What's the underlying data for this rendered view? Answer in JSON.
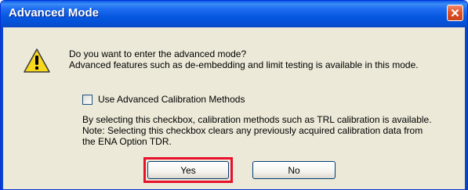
{
  "window": {
    "title": "Advanced Mode",
    "close_icon": "close-icon"
  },
  "dialog": {
    "icon": "warning-icon",
    "question": "Do you want to enter the advanced mode?",
    "description": "Advanced features such as de-embedding and limit testing is available in this mode.",
    "checkbox_label": "Use Advanced Calibration Methods",
    "checkbox_checked": false,
    "note_line1": "By selecting this checkbox, calibration methods such as TRL calibration is available.",
    "note_line2": "Note: Selecting this checkbox clears any previously acquired calibration data from",
    "note_line3": "the ENA Option TDR."
  },
  "buttons": {
    "yes_label": "Yes",
    "no_label": "No"
  },
  "colors": {
    "titlebar": "#0657e0",
    "dialog_bg": "#ece9d8",
    "highlight": "#e8112d"
  }
}
